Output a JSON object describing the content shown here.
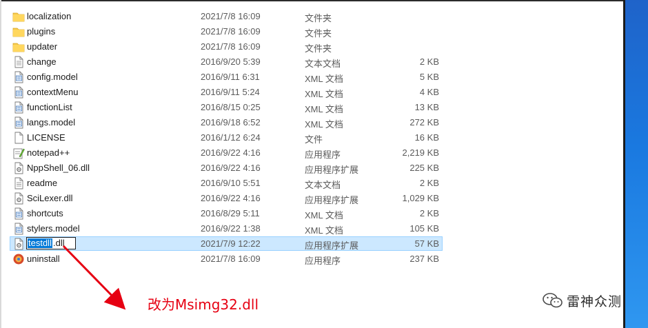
{
  "files": [
    {
      "name": "localization",
      "date": "2021/7/8 16:09",
      "type": "文件夹",
      "size": "",
      "icon": "folder-icon"
    },
    {
      "name": "plugins",
      "date": "2021/7/8 16:09",
      "type": "文件夹",
      "size": "",
      "icon": "folder-icon"
    },
    {
      "name": "updater",
      "date": "2021/7/8 16:09",
      "type": "文件夹",
      "size": "",
      "icon": "folder-icon"
    },
    {
      "name": "change",
      "date": "2016/9/20 5:39",
      "type": "文本文档",
      "size": "2 KB",
      "icon": "text-file-icon"
    },
    {
      "name": "config.model",
      "date": "2016/9/11 6:31",
      "type": "XML 文档",
      "size": "5 KB",
      "icon": "xml-file-icon"
    },
    {
      "name": "contextMenu",
      "date": "2016/9/11 5:24",
      "type": "XML 文档",
      "size": "4 KB",
      "icon": "xml-file-icon"
    },
    {
      "name": "functionList",
      "date": "2016/8/15 0:25",
      "type": "XML 文档",
      "size": "13 KB",
      "icon": "xml-file-icon"
    },
    {
      "name": "langs.model",
      "date": "2016/9/18 6:52",
      "type": "XML 文档",
      "size": "272 KB",
      "icon": "xml-file-icon"
    },
    {
      "name": "LICENSE",
      "date": "2016/1/12 6:24",
      "type": "文件",
      "size": "16 KB",
      "icon": "blank-file-icon"
    },
    {
      "name": "notepad++",
      "date": "2016/9/22 4:16",
      "type": "应用程序",
      "size": "2,219 KB",
      "icon": "notepad-app-icon"
    },
    {
      "name": "NppShell_06.dll",
      "date": "2016/9/22 4:16",
      "type": "应用程序扩展",
      "size": "225 KB",
      "icon": "dll-file-icon"
    },
    {
      "name": "readme",
      "date": "2016/9/10 5:51",
      "type": "文本文档",
      "size": "2 KB",
      "icon": "text-file-icon"
    },
    {
      "name": "SciLexer.dll",
      "date": "2016/9/22 4:16",
      "type": "应用程序扩展",
      "size": "1,029 KB",
      "icon": "dll-file-icon"
    },
    {
      "name": "shortcuts",
      "date": "2016/8/29 5:11",
      "type": "XML 文档",
      "size": "2 KB",
      "icon": "xml-file-icon"
    },
    {
      "name": "stylers.model",
      "date": "2016/9/22 1:38",
      "type": "XML 文档",
      "size": "105 KB",
      "icon": "xml-file-icon"
    },
    {
      "name": "testdll.dll",
      "date": "2021/7/9 12:22",
      "type": "应用程序扩展",
      "size": "57 KB",
      "icon": "dll-file-icon",
      "selected": true,
      "renaming": true
    },
    {
      "name": "uninstall",
      "date": "2021/7/8 16:09",
      "type": "应用程序",
      "size": "237 KB",
      "icon": "uninstall-app-icon"
    }
  ],
  "rename": {
    "selected_part": "testdll",
    "rest": ".dll"
  },
  "annotation": {
    "text": "改为Msimg32.dll",
    "color": "#e60012"
  },
  "watermark": {
    "text": "雷神众测"
  },
  "colors": {
    "selection_bg": "#cce8ff",
    "selection_border": "#99d1ff",
    "folder": "#f6c94e",
    "desktop": "#1a79e0"
  }
}
